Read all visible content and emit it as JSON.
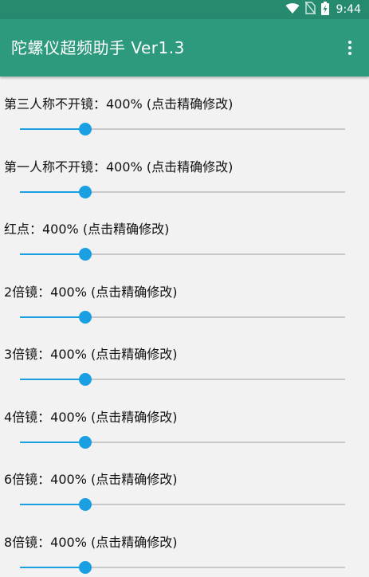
{
  "status_bar": {
    "time": "9:44",
    "icons": [
      "wifi-icon",
      "no-sim-icon",
      "battery-charging-icon"
    ]
  },
  "app_bar": {
    "title": "陀螺仪超频助手 Ver1.3",
    "overflow_icon": "more-vert-icon",
    "background_color": "#2e9a7d"
  },
  "accent_color": "#1aa0e2",
  "settings": [
    {
      "label": "第三人称不开镜：400%  (点击精确修改)",
      "value_fraction": 0.2
    },
    {
      "label": "第一人称不开镜：400%  (点击精确修改)",
      "value_fraction": 0.2
    },
    {
      "label": "红点：400%  (点击精确修改)",
      "value_fraction": 0.2
    },
    {
      "label": "2倍镜：400%  (点击精确修改)",
      "value_fraction": 0.2
    },
    {
      "label": "3倍镜：400%  (点击精确修改)",
      "value_fraction": 0.2
    },
    {
      "label": "4倍镜：400%  (点击精确修改)",
      "value_fraction": 0.2
    },
    {
      "label": "6倍镜：400%  (点击精确修改)",
      "value_fraction": 0.2
    },
    {
      "label": "8倍镜：400%  (点击精确修改)",
      "value_fraction": 0.2
    }
  ]
}
